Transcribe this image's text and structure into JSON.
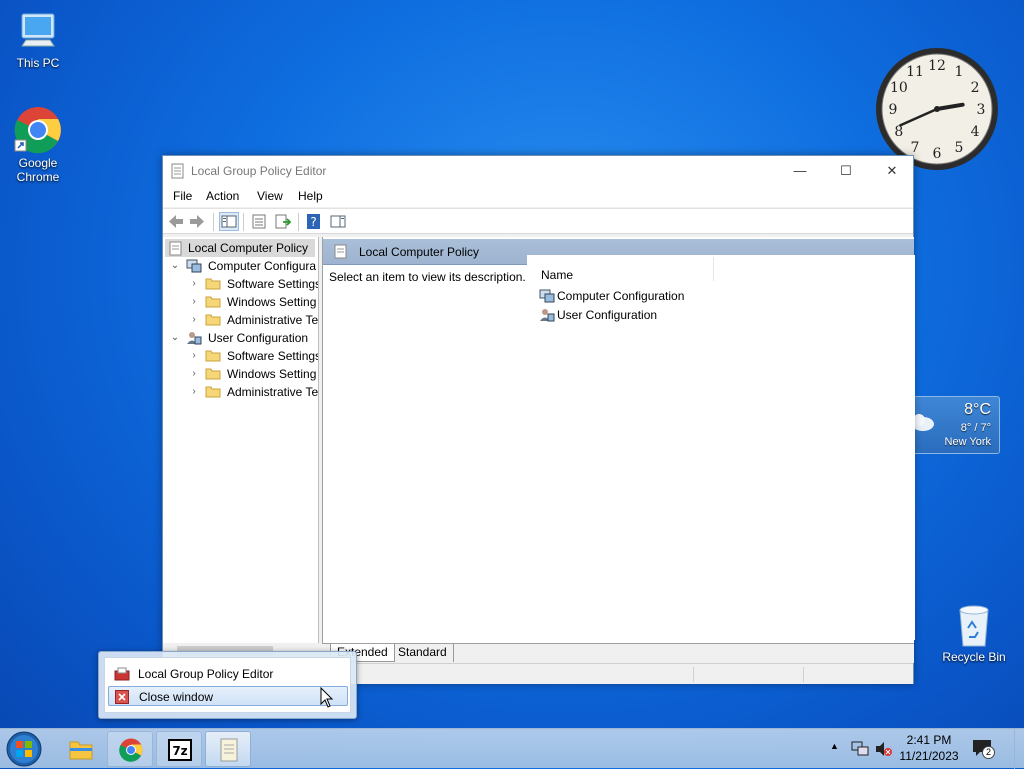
{
  "desktop": {
    "icons": [
      {
        "name": "This PC",
        "icon": "computer-icon"
      },
      {
        "name": "Google\nChrome",
        "icon": "chrome-icon"
      },
      {
        "name": "Recycle Bin",
        "icon": "recycle-bin-icon"
      }
    ],
    "clock_gadget": {
      "hour": 2,
      "minute": 41,
      "numerals": [
        "12",
        "1",
        "2",
        "3",
        "4",
        "5",
        "6",
        "7",
        "8",
        "9",
        "10",
        "11"
      ]
    },
    "weather": {
      "temp": "8°C",
      "range": "8° / 7°",
      "city": "New York"
    }
  },
  "window": {
    "title": "Local Group Policy Editor",
    "controls": {
      "minimize": "—",
      "maximize": "☐",
      "close": "✕"
    },
    "menu": [
      "File",
      "Action",
      "View",
      "Help"
    ],
    "tree": [
      {
        "label": "Local Computer Policy",
        "level": 0,
        "selected": true
      },
      {
        "label": "Computer Configura",
        "level": 1,
        "expanded": true
      },
      {
        "label": "Software Settings",
        "level": 2
      },
      {
        "label": "Windows Setting",
        "level": 2
      },
      {
        "label": "Administrative Te",
        "level": 2
      },
      {
        "label": "User Configuration",
        "level": 1,
        "expanded": true
      },
      {
        "label": "Software Settings",
        "level": 2
      },
      {
        "label": "Windows Setting",
        "level": 2
      },
      {
        "label": "Administrative Te",
        "level": 2
      }
    ],
    "right_header": "Local Computer Policy",
    "description": "Select an item to view its description.",
    "column_name": "Name",
    "items": [
      "Computer Configuration",
      "User Configuration"
    ],
    "tabs": [
      "Extended",
      "Standard"
    ]
  },
  "jumplist": {
    "items": [
      {
        "label": "Local Group Policy Editor",
        "icon": "gpedit-icon"
      },
      {
        "label": "Close window",
        "icon": "close-window-icon",
        "highlighted": true
      }
    ]
  },
  "taskbar": {
    "time": "2:41 PM",
    "date": "11/21/2023",
    "notification_count": "2",
    "apps": [
      "file-explorer-icon",
      "chrome-icon",
      "7zip-icon",
      "gpedit-icon"
    ]
  },
  "colors": {
    "desktop": "#0f6fe0",
    "selection": "#d9d9d9",
    "header": "#9db3cf"
  }
}
